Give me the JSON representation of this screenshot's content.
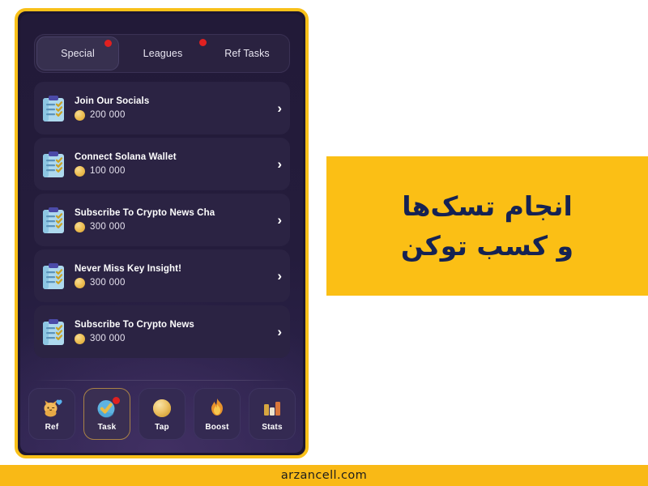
{
  "app": {
    "tabs": [
      {
        "label": "Special",
        "active": true,
        "badge": true
      },
      {
        "label": "Leagues",
        "active": false,
        "badge": true
      },
      {
        "label": "Ref Tasks",
        "active": false,
        "badge": false
      }
    ],
    "tasks": [
      {
        "icon": "clipboard-checklist-icon",
        "title": "Join Our Socials",
        "reward": "200 000",
        "chevron": "›"
      },
      {
        "icon": "clipboard-checklist-icon",
        "title": "Connect Solana Wallet",
        "reward": "100 000",
        "chevron": "›"
      },
      {
        "icon": "clipboard-checklist-icon",
        "title": "Subscribe To Crypto News Cha",
        "reward": "300 000",
        "chevron": "›"
      },
      {
        "icon": "clipboard-checklist-icon",
        "title": "Never Miss Key Insight!",
        "reward": "300 000",
        "chevron": "›"
      },
      {
        "icon": "clipboard-checklist-icon",
        "title": "Subscribe To Crypto News",
        "reward": "300 000",
        "chevron": "›"
      }
    ],
    "bottom_nav": [
      {
        "label": "Ref",
        "icon": "cat-heart-icon",
        "active": false,
        "badge": false
      },
      {
        "label": "Task",
        "icon": "check-circle-icon",
        "active": true,
        "badge": true
      },
      {
        "label": "Tap",
        "icon": "coin-icon",
        "active": false,
        "badge": false
      },
      {
        "label": "Boost",
        "icon": "flame-icon",
        "active": false,
        "badge": false
      },
      {
        "label": "Stats",
        "icon": "bar-chart-icon",
        "active": false,
        "badge": false
      }
    ]
  },
  "promo": {
    "line1": "انجام تسک‌ها",
    "line2": "و کسب توکن"
  },
  "footer": {
    "site": "arzancell.com"
  },
  "colors": {
    "frame_yellow": "#F8C019",
    "panel_yellow": "#FBBF15",
    "footer_yellow": "#F9B916",
    "headline_navy": "#152253",
    "badge_red": "#e02020",
    "screen_bg": "#241c3c",
    "card_bg": "#2b2343",
    "active_border": "#a98246"
  }
}
